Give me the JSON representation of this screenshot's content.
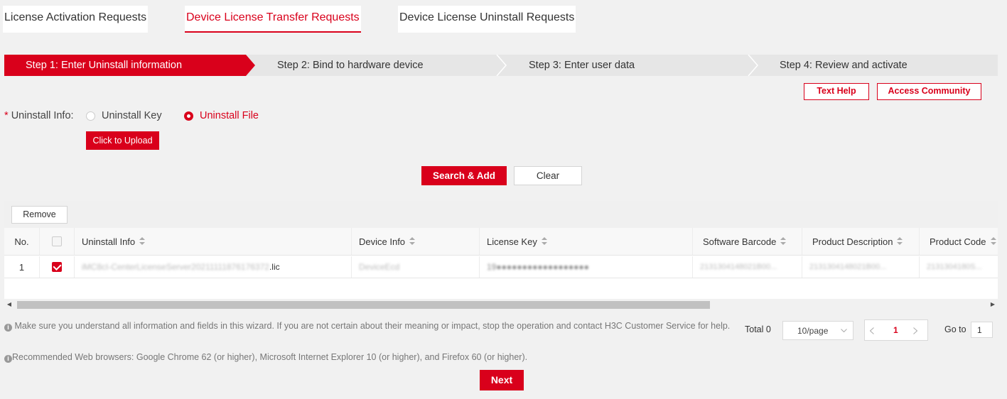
{
  "tabs": [
    {
      "label": "License Activation Requests"
    },
    {
      "label": "Device License Transfer Requests"
    },
    {
      "label": "Device License Uninstall Requests"
    }
  ],
  "steps": [
    {
      "label": "Step 1: Enter Uninstall information"
    },
    {
      "label": "Step 2: Bind to hardware device"
    },
    {
      "label": "Step 3: Enter user data"
    },
    {
      "label": "Step 4: Review and activate"
    }
  ],
  "help": {
    "text_help": "Text Help",
    "community": "Access Community"
  },
  "form": {
    "required_mark": "*",
    "label": "Uninstall Info:",
    "options": [
      "Uninstall Key",
      "Uninstall File"
    ],
    "selected": "Uninstall File",
    "upload_label": "Click to Upload"
  },
  "actions": {
    "search_add": "Search & Add",
    "clear": "Clear"
  },
  "table": {
    "remove_label": "Remove",
    "columns": [
      "No.",
      "Uninstall Info",
      "Device Info",
      "License Key",
      "Software Barcode",
      "Product Description",
      "Product Code"
    ],
    "rows": [
      {
        "no": "1",
        "uninstall_info_blurred": "iMC8cI-CenterLicenseServer20211111876176372",
        "uninstall_info_ext": ".lic",
        "device_info": "DeviceEcd",
        "license_key": "19●●●●●●●●●●●●●●●●●●",
        "software_barcode": "2131304148021B00...",
        "product_description": "2131304148021B00...",
        "product_code": "2131304180S..."
      }
    ]
  },
  "notes": {
    "note1": "Make sure you understand all information and fields in this wizard. If you are not certain about their meaning or impact, stop the operation and contact H3C Customer Service for help.",
    "note2": "Recommended Web browsers: Google Chrome 62 (or higher), Microsoft Internet Explorer 10 (or higher), and Firefox 60 (or higher)."
  },
  "pager": {
    "total": "Total 0",
    "page_size": "10/page",
    "current_page": "1",
    "goto_label": "Go to",
    "goto_value": "1"
  },
  "next_label": "Next",
  "colors": {
    "accent": "#d9001b",
    "background": "#f1f1f1",
    "step_bar": "#e6e6e6"
  }
}
